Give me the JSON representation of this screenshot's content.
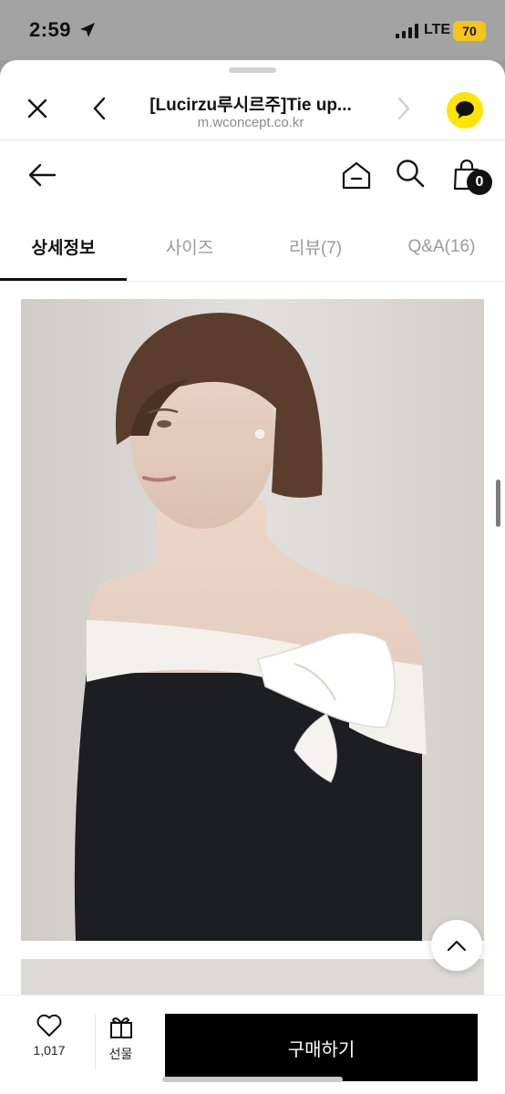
{
  "status": {
    "time": "2:59",
    "network": "LTE",
    "battery": "70"
  },
  "browser": {
    "title": "[Lucirzu루시르주]Tie up...",
    "url": "m.wconcept.co.kr"
  },
  "cart": {
    "count": "0"
  },
  "tabs": [
    {
      "label": "상세정보",
      "active": true
    },
    {
      "label": "사이즈",
      "active": false
    },
    {
      "label": "리뷰(7)",
      "active": false
    },
    {
      "label": "Q&A(16)",
      "active": false
    }
  ],
  "actions": {
    "likes": "1,017",
    "gift_label": "선물",
    "buy_label": "구매하기"
  },
  "colors": {
    "accent": "#111111",
    "kakao": "#fee500",
    "battery": "#f5c518"
  }
}
